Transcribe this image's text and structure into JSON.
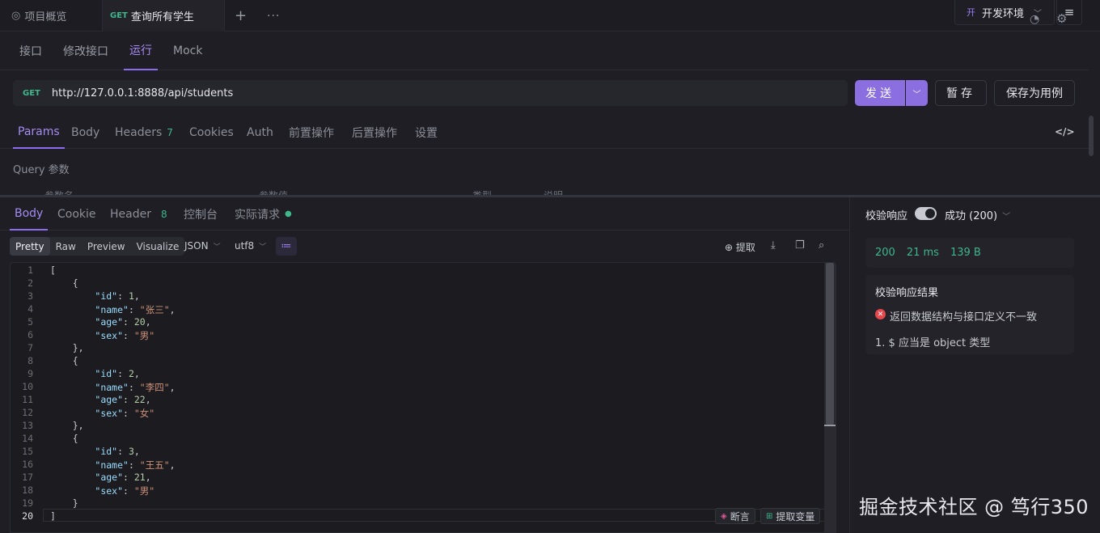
{
  "tabs": {
    "overview_label": "项目概览",
    "active_method": "GET",
    "active_label": "查询所有学生",
    "add_symbol": "+",
    "more_symbol": "···"
  },
  "env": {
    "badge": "开",
    "label": "开发环境",
    "menu_symbol": "≡"
  },
  "subtabs": [
    "接口",
    "修改接口",
    "运行",
    "Mock"
  ],
  "subtab_active": "运行",
  "url": {
    "method": "GET",
    "value": "http://127.0.0.1:8888/api/students"
  },
  "actions": {
    "send": "发送",
    "save": "暂存",
    "save_case": "保存为用例"
  },
  "request_tabs": {
    "params": "Params",
    "body": "Body",
    "headers": "Headers",
    "headers_count": "7",
    "cookies": "Cookies",
    "auth": "Auth",
    "pre": "前置操作",
    "post": "后置操作",
    "settings": "设置"
  },
  "query": {
    "label": "Query 参数",
    "columns": [
      "参数名",
      "参数值",
      "类型",
      "说明"
    ]
  },
  "response_tabs": {
    "body": "Body",
    "cookie": "Cookie",
    "header": "Header",
    "header_count": "8",
    "console": "控制台",
    "actual": "实际请求"
  },
  "view": {
    "modes": [
      "Pretty",
      "Raw",
      "Preview",
      "Visualize"
    ],
    "active_mode": "Pretty",
    "format": "JSON",
    "encoding": "utf8",
    "extract": "提取"
  },
  "code_lines": [
    [
      [
        "p",
        "["
      ]
    ],
    [
      [
        "p",
        "    {"
      ]
    ],
    [
      [
        "p",
        "        "
      ],
      [
        "k",
        "\"id\""
      ],
      [
        "p",
        ": "
      ],
      [
        "n",
        "1"
      ],
      [
        "p",
        ","
      ]
    ],
    [
      [
        "p",
        "        "
      ],
      [
        "k",
        "\"name\""
      ],
      [
        "p",
        ": "
      ],
      [
        "s",
        "\"张三\""
      ],
      [
        "p",
        ","
      ]
    ],
    [
      [
        "p",
        "        "
      ],
      [
        "k",
        "\"age\""
      ],
      [
        "p",
        ": "
      ],
      [
        "n",
        "20"
      ],
      [
        "p",
        ","
      ]
    ],
    [
      [
        "p",
        "        "
      ],
      [
        "k",
        "\"sex\""
      ],
      [
        "p",
        ": "
      ],
      [
        "s",
        "\"男\""
      ]
    ],
    [
      [
        "p",
        "    },"
      ]
    ],
    [
      [
        "p",
        "    {"
      ]
    ],
    [
      [
        "p",
        "        "
      ],
      [
        "k",
        "\"id\""
      ],
      [
        "p",
        ": "
      ],
      [
        "n",
        "2"
      ],
      [
        "p",
        ","
      ]
    ],
    [
      [
        "p",
        "        "
      ],
      [
        "k",
        "\"name\""
      ],
      [
        "p",
        ": "
      ],
      [
        "s",
        "\"李四\""
      ],
      [
        "p",
        ","
      ]
    ],
    [
      [
        "p",
        "        "
      ],
      [
        "k",
        "\"age\""
      ],
      [
        "p",
        ": "
      ],
      [
        "n",
        "22"
      ],
      [
        "p",
        ","
      ]
    ],
    [
      [
        "p",
        "        "
      ],
      [
        "k",
        "\"sex\""
      ],
      [
        "p",
        ": "
      ],
      [
        "s",
        "\"女\""
      ]
    ],
    [
      [
        "p",
        "    },"
      ]
    ],
    [
      [
        "p",
        "    {"
      ]
    ],
    [
      [
        "p",
        "        "
      ],
      [
        "k",
        "\"id\""
      ],
      [
        "p",
        ": "
      ],
      [
        "n",
        "3"
      ],
      [
        "p",
        ","
      ]
    ],
    [
      [
        "p",
        "        "
      ],
      [
        "k",
        "\"name\""
      ],
      [
        "p",
        ": "
      ],
      [
        "s",
        "\"王五\""
      ],
      [
        "p",
        ","
      ]
    ],
    [
      [
        "p",
        "        "
      ],
      [
        "k",
        "\"age\""
      ],
      [
        "p",
        ": "
      ],
      [
        "n",
        "21"
      ],
      [
        "p",
        ","
      ]
    ],
    [
      [
        "p",
        "        "
      ],
      [
        "k",
        "\"sex\""
      ],
      [
        "p",
        ": "
      ],
      [
        "s",
        "\"男\""
      ]
    ],
    [
      [
        "p",
        "    }"
      ]
    ],
    [
      [
        "p",
        "]"
      ]
    ]
  ],
  "current_line": 20,
  "editor_actions": {
    "breakpoint": "断言",
    "extract_var": "提取变量"
  },
  "verify": {
    "label": "校验响应",
    "enabled": true,
    "status": "成功 (200)",
    "stats": {
      "code": "200",
      "time": "21 ms",
      "size": "139 B"
    },
    "result_title": "校验响应结果",
    "error_text": "返回数据结构与接口定义不一致",
    "error_detail": "1. $ 应当是 object 类型"
  },
  "watermark": "掘金技术社区 @ 笃行350",
  "colors": {
    "accent": "#8b6fe0",
    "get_method": "#3fb68b",
    "error": "#e5484d"
  }
}
